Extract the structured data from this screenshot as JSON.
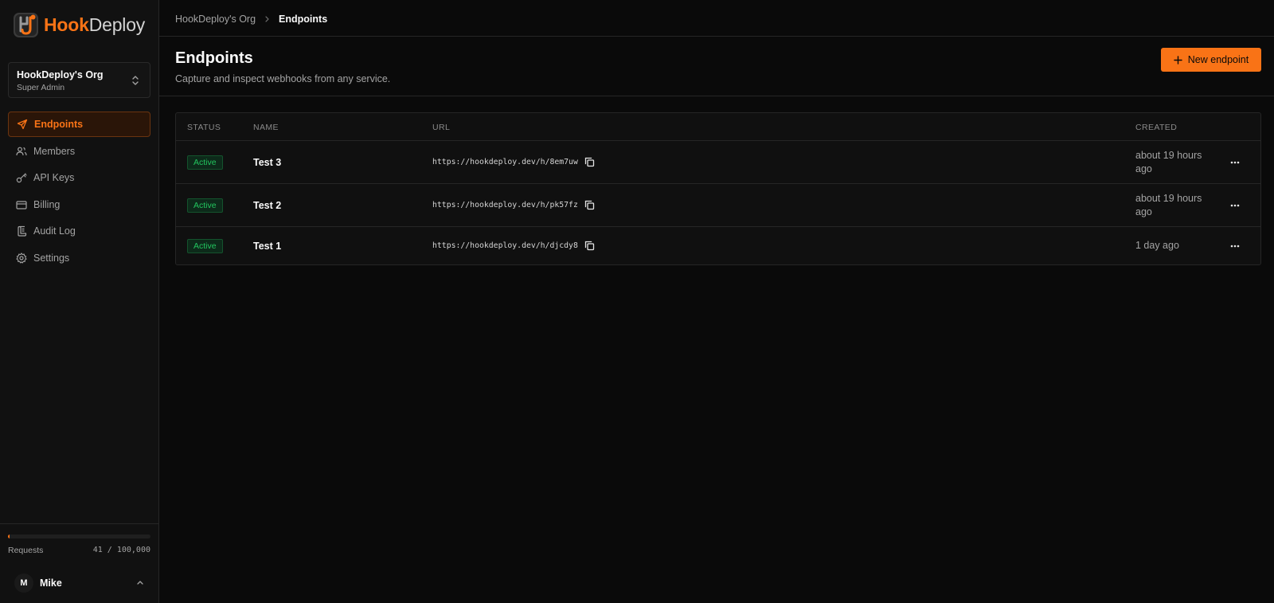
{
  "brand": {
    "hook": "Hook",
    "deploy": "Deploy",
    "accent": "#f97316"
  },
  "org": {
    "name": "HookDeploy's Org",
    "role": "Super Admin"
  },
  "nav": [
    {
      "label": "Endpoints",
      "icon": "send-icon",
      "active": true
    },
    {
      "label": "Members",
      "icon": "users-icon",
      "active": false
    },
    {
      "label": "API Keys",
      "icon": "key-icon",
      "active": false
    },
    {
      "label": "Billing",
      "icon": "credit-card-icon",
      "active": false
    },
    {
      "label": "Audit Log",
      "icon": "scroll-icon",
      "active": false
    },
    {
      "label": "Settings",
      "icon": "gear-icon",
      "active": false
    }
  ],
  "usage": {
    "label": "Requests",
    "count": "41 / 100,000",
    "fraction": 0.00041
  },
  "user": {
    "initial": "M",
    "name": "Mike"
  },
  "breadcrumb": {
    "org": "HookDeploy's Org",
    "current": "Endpoints"
  },
  "page": {
    "title": "Endpoints",
    "subtitle": "Capture and inspect webhooks from any service.",
    "new_button": "New endpoint"
  },
  "table": {
    "columns": {
      "status": "STATUS",
      "name": "NAME",
      "url": "URL",
      "created": "CREATED"
    },
    "rows": [
      {
        "status": "Active",
        "name": "Test 3",
        "url": "https://hookdeploy.dev/h/8em7uw",
        "created": "about 19 hours ago"
      },
      {
        "status": "Active",
        "name": "Test 2",
        "url": "https://hookdeploy.dev/h/pk57fz",
        "created": "about 19 hours ago"
      },
      {
        "status": "Active",
        "name": "Test 1",
        "url": "https://hookdeploy.dev/h/djcdy8",
        "created": "1 day ago"
      }
    ]
  }
}
